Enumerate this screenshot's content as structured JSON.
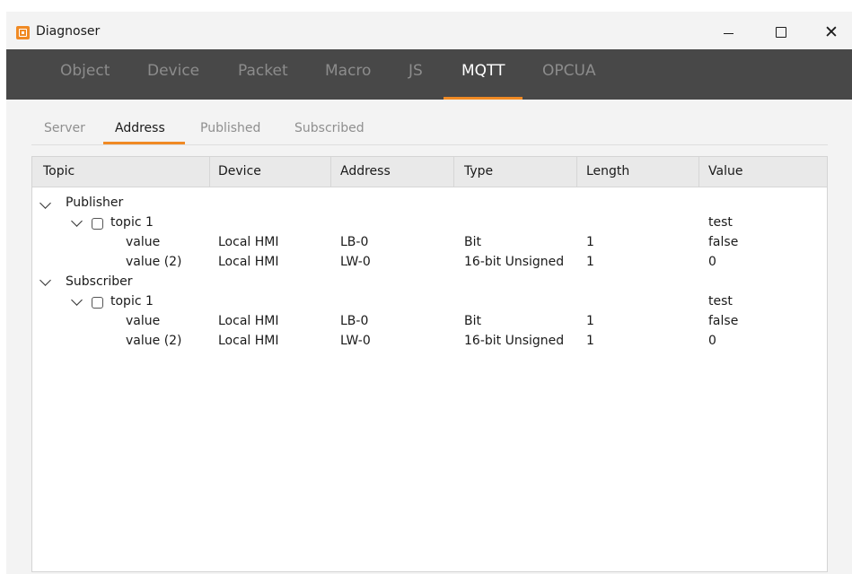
{
  "window": {
    "title": "Diagnoser"
  },
  "top_tabs": [
    {
      "label": "Object",
      "active": false
    },
    {
      "label": "Device",
      "active": false
    },
    {
      "label": "Packet",
      "active": false
    },
    {
      "label": "Macro",
      "active": false
    },
    {
      "label": "JS",
      "active": false
    },
    {
      "label": "MQTT",
      "active": true
    },
    {
      "label": "OPCUA",
      "active": false
    }
  ],
  "sub_tabs": [
    {
      "label": "Server",
      "active": false
    },
    {
      "label": "Address",
      "active": true
    },
    {
      "label": "Published",
      "active": false
    },
    {
      "label": "Subscribed",
      "active": false
    }
  ],
  "table": {
    "columns": [
      "Topic",
      "Device",
      "Address",
      "Type",
      "Length",
      "Value"
    ],
    "groups": [
      {
        "name": "Publisher",
        "expanded": true,
        "topics": [
          {
            "name": "topic 1",
            "value": "test",
            "checked": false,
            "expanded": true,
            "items": [
              {
                "name": "value",
                "device": "Local HMI",
                "address": "LB-0",
                "type": "Bit",
                "length": "1",
                "value": "false"
              },
              {
                "name": "value (2)",
                "device": "Local HMI",
                "address": "LW-0",
                "type": "16-bit Unsigned",
                "length": "1",
                "value": "0"
              }
            ]
          }
        ]
      },
      {
        "name": "Subscriber",
        "expanded": true,
        "topics": [
          {
            "name": "topic 1",
            "value": "test",
            "checked": false,
            "expanded": true,
            "items": [
              {
                "name": "value",
                "device": "Local HMI",
                "address": "LB-0",
                "type": "Bit",
                "length": "1",
                "value": "false"
              },
              {
                "name": "value (2)",
                "device": "Local HMI",
                "address": "LW-0",
                "type": "16-bit Unsigned",
                "length": "1",
                "value": "0"
              }
            ]
          }
        ]
      }
    ]
  },
  "colors": {
    "accent": "#f08a24",
    "tabbar_bg": "#484848",
    "window_bg": "#f3f3f3"
  },
  "icons": {
    "app": "diagnoser-app-icon",
    "minimize": "minimize-icon",
    "maximize": "maximize-icon",
    "close": "close-icon",
    "expand": "chevron-down-icon",
    "checkbox": "checkbox-icon"
  }
}
